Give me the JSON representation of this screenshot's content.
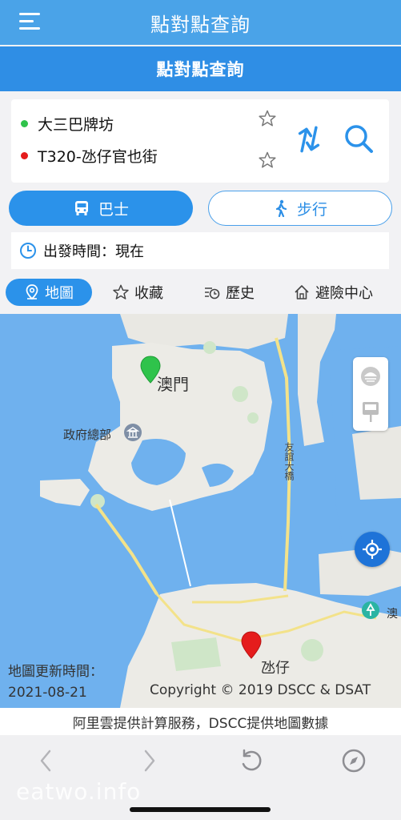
{
  "app": {
    "title": "點對點查詢",
    "subtitle": "點對點查詢"
  },
  "route": {
    "origin": "大三巴牌坊",
    "destination": "T320-氹仔官也街"
  },
  "modes": {
    "bus_label": "巴士",
    "walk_label": "步行",
    "selected": "bus"
  },
  "departure": {
    "label": "出發時間：現在"
  },
  "tabs": [
    {
      "label": "地圖",
      "icon": "map-pin-icon",
      "active": true
    },
    {
      "label": "收藏",
      "icon": "star-icon",
      "active": false
    },
    {
      "label": "歷史",
      "icon": "history-icon",
      "active": false
    },
    {
      "label": "避險中心",
      "icon": "shelter-icon",
      "active": false
    }
  ],
  "map": {
    "labels": {
      "macau": "澳門",
      "gov": "政府總部",
      "bridge": "友誼大橋",
      "taipa": "氹仔",
      "edge": "澳"
    },
    "update_label": "地圖更新時間：",
    "update_date": "2021-08-21",
    "copyright": "Copyright © 2019 DSCC & DSAT"
  },
  "credit": "阿里雲提供計算服務，DSCC提供地圖數據",
  "watermark": "eatwo.info",
  "colors": {
    "header": "#4aa3e8",
    "subheader": "#2f8ee5",
    "accent": "#2b92ea",
    "origin_pin": "#2fc34b",
    "destination_pin": "#e51c1c",
    "sea": "#6fb1ee",
    "land": "#ecebe6"
  }
}
